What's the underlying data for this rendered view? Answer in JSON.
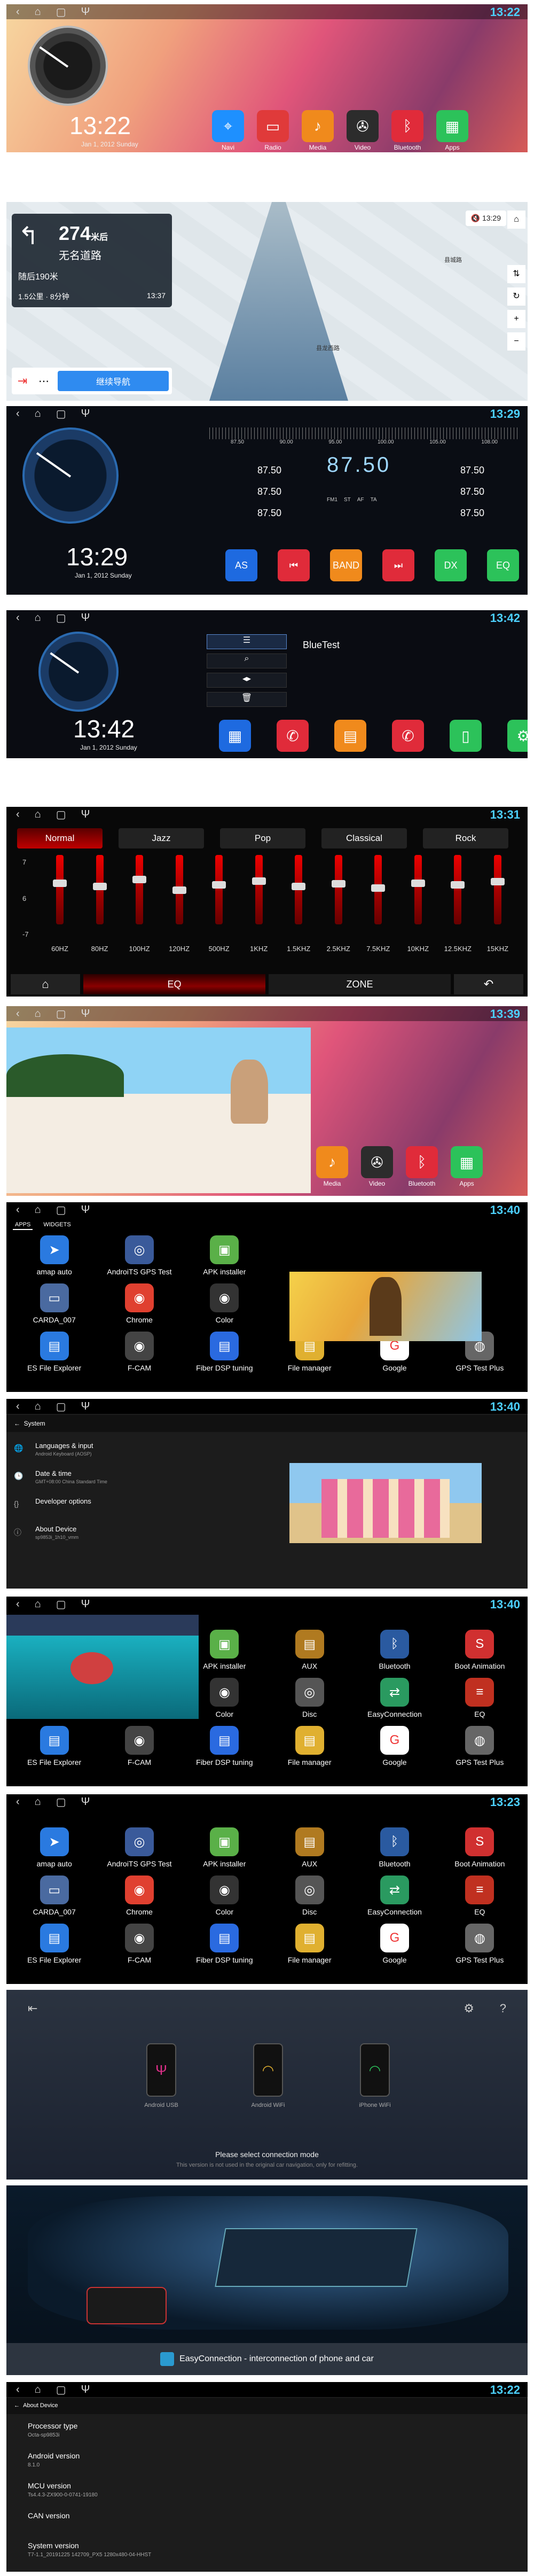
{
  "s1": {
    "time": "13:22",
    "date": "Jan 1, 2012  Sunday",
    "apps": [
      {
        "label": "Navi",
        "icon": "map-pin-icon",
        "color": "#1e90ff"
      },
      {
        "label": "Radio",
        "icon": "radio-icon",
        "color": "#e03a3a"
      },
      {
        "label": "Media",
        "icon": "music-icon",
        "color": "#f08a1c"
      },
      {
        "label": "Video",
        "icon": "film-icon",
        "color": "#2c2c2c"
      },
      {
        "label": "Bluetooth",
        "icon": "bluetooth-icon",
        "color": "#e02b3a"
      },
      {
        "label": "Apps",
        "icon": "apps-grid-icon",
        "color": "#2cc25a"
      }
    ]
  },
  "s2": {
    "time": "13:29",
    "dist_val": "274",
    "dist_unit": "米",
    "dist_after": "后",
    "road": "无名道路",
    "next_road": "随后190米",
    "eta_info": "1.5公里 · 8分钟",
    "arrive": "13:37",
    "continue": "继续导航",
    "place1": "县龙西路",
    "place2": "县城路"
  },
  "s3": {
    "time": "13:29",
    "date": "Jan 1, 2012  Sunday",
    "freq": "87.50",
    "presets": [
      "87.50",
      "87.50",
      "87.50",
      "87.50",
      "87.50",
      "87.50"
    ],
    "scale": [
      "87.50",
      "90.00",
      "95.00",
      "100.00",
      "105.00",
      "108.00"
    ],
    "buttons": [
      "AS",
      "⏮",
      "BAND",
      "⏭",
      "DX",
      "EQ"
    ],
    "band_tags": [
      "FM1",
      "ST",
      "AF",
      "TA"
    ]
  },
  "s4": {
    "time": "13:42",
    "date": "Jan 1, 2012  Sunday",
    "device": "BlueTest"
  },
  "s5": {
    "time": "13:31",
    "modes": [
      "Normal",
      "Jazz",
      "Pop",
      "Classical",
      "Rock"
    ],
    "levels": [
      "7",
      "6",
      "-7"
    ],
    "bands": [
      "60HZ",
      "80HZ",
      "100HZ",
      "120HZ",
      "500HZ",
      "1KHZ",
      "1.5KHZ",
      "2.5KHZ",
      "7.5KHZ",
      "10KHZ",
      "12.5KHZ",
      "15KHZ"
    ],
    "eq": "EQ",
    "zone": "ZONE"
  },
  "s6": {
    "time": "13:39",
    "apps": [
      {
        "label": "Media",
        "color": "#f08a1c"
      },
      {
        "label": "Video",
        "color": "#2c2c2c"
      },
      {
        "label": "Bluetooth",
        "color": "#e02b3a"
      },
      {
        "label": "Apps",
        "color": "#2cc25a"
      }
    ]
  },
  "s7": {
    "time": "13:40",
    "tabs": [
      "APPS",
      "WIDGETS"
    ],
    "apps": [
      "amap auto",
      "AndroiTS GPS Test",
      "APK installer",
      "AUX",
      "Bluetooth",
      "Boot Animation",
      "CARDA_007",
      "Chrome",
      "Color",
      "Disc",
      "EasyConnection",
      "EQ",
      "ES File Explorer",
      "F-CAM",
      "Fiber DSP tuning",
      "File manager",
      "Google",
      "GPS Test Plus"
    ]
  },
  "s8": {
    "time": "13:40",
    "title": "System",
    "items": [
      {
        "t": "Languages & input",
        "s": "Android Keyboard (AOSP)"
      },
      {
        "t": "Date & time",
        "s": "GMT+08:00 China Standard Time"
      },
      {
        "t": "Developer options",
        "s": ""
      },
      {
        "t": "About Device",
        "s": "sp9853i_1h10_vmm"
      }
    ]
  },
  "s9": {
    "time": "13:40"
  },
  "s10": {
    "time": "13:23"
  },
  "s11": {
    "items": [
      "Android USB",
      "Android WiFi",
      "iPhone WiFi"
    ],
    "title": "Please select connection mode",
    "sub": "This version is not used in the original car navigation, only for refitting."
  },
  "s12": {
    "banner": "EasyConnection - interconnection of phone and car"
  },
  "s13": {
    "time": "13:22",
    "title": "About Device",
    "items": [
      {
        "t": "Processor type",
        "v": "Octa-sp9853i"
      },
      {
        "t": "Android version",
        "v": "8.1.0"
      },
      {
        "t": "MCU version",
        "v": "Ts4.4.3-ZX900-0-0741-19180"
      },
      {
        "t": "CAN version",
        "v": ""
      },
      {
        "t": "System version",
        "v": "T7-1.1_20191225 142709_PX5 1280x480-04-HHST"
      }
    ]
  }
}
